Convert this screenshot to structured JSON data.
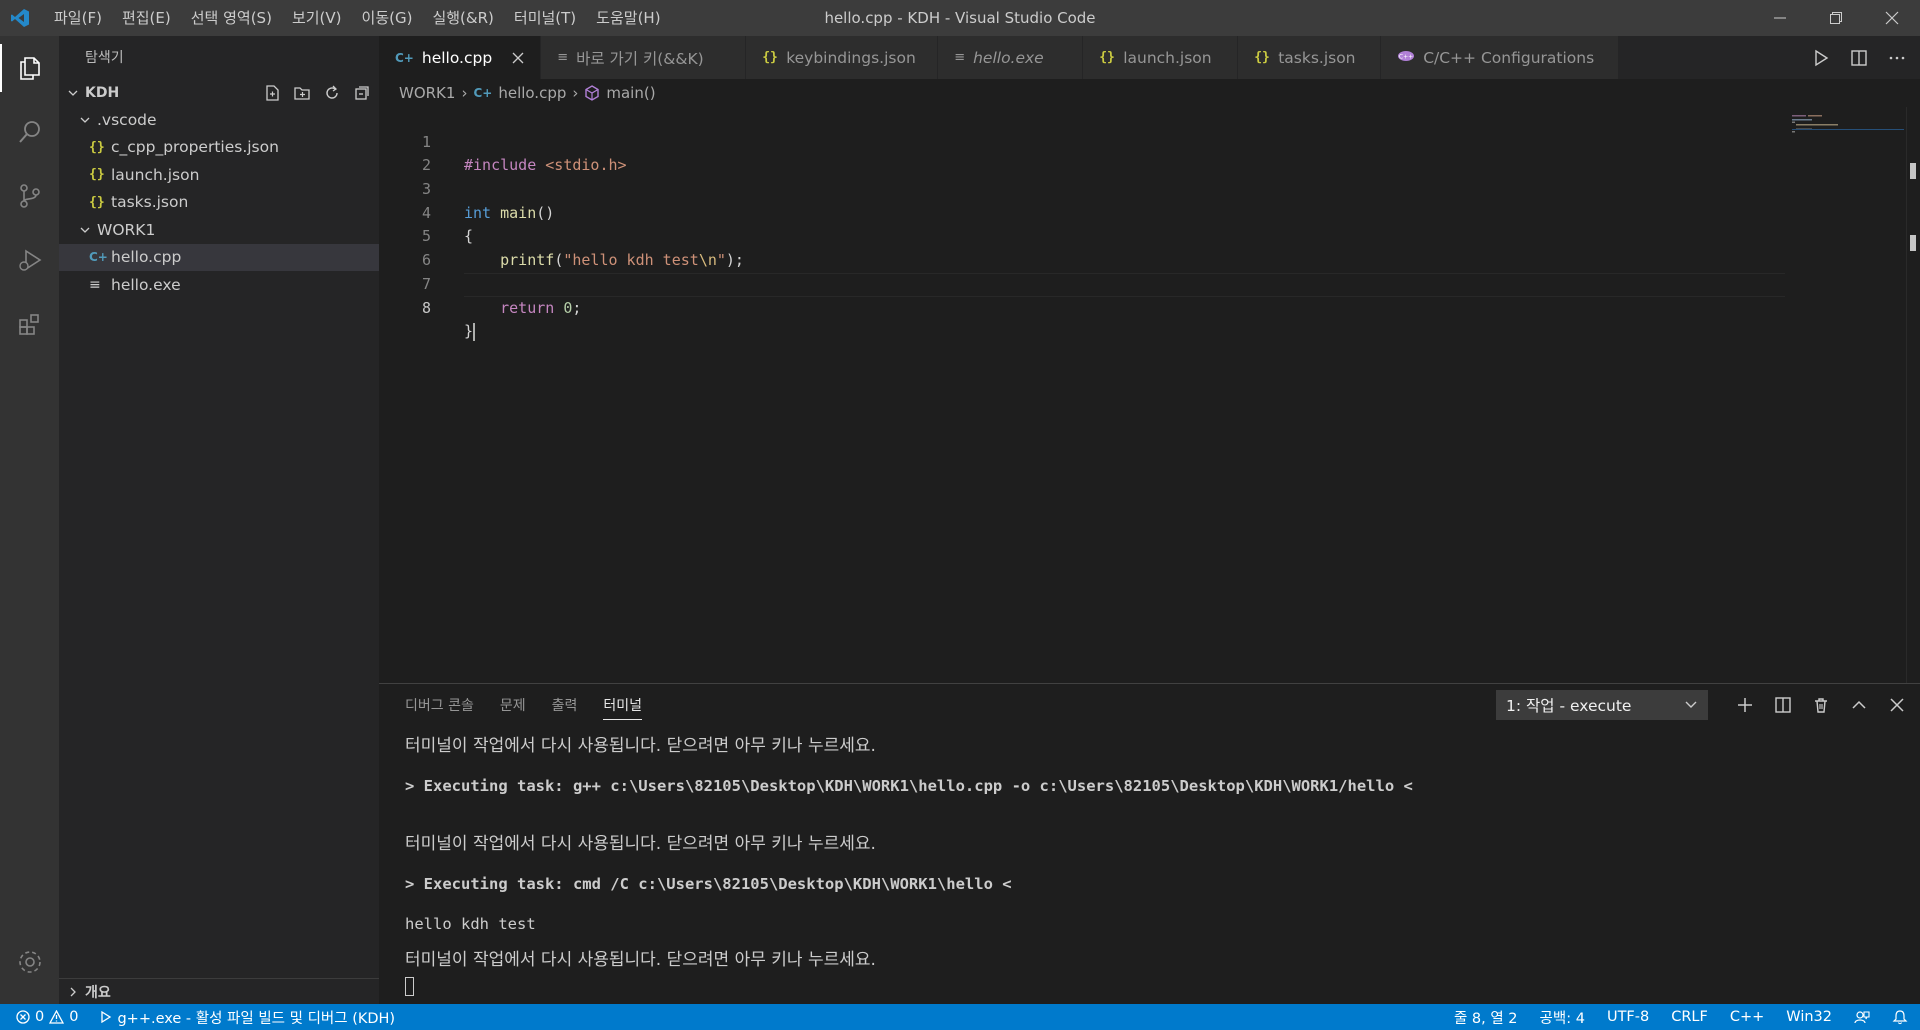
{
  "window": {
    "title": "hello.cpp - KDH - Visual Studio Code",
    "menu": [
      "파일(F)",
      "편집(E)",
      "선택 영역(S)",
      "보기(V)",
      "이동(G)",
      "실행(&R)",
      "터미널(T)",
      "도움말(H)"
    ]
  },
  "sidebar": {
    "title": "탐색기",
    "workspace": "KDH",
    "tree": {
      "vscode_folder": ".vscode",
      "vscode_files": [
        "c_cpp_properties.json",
        "launch.json",
        "tasks.json"
      ],
      "work_folder": "WORK1",
      "work_files": [
        "hello.cpp",
        "hello.exe"
      ]
    },
    "outline_label": "개요"
  },
  "tabs": [
    {
      "label": "hello.cpp",
      "icon": "cpp-icon"
    },
    {
      "label": "바로 가기 키(&&K)",
      "icon": "list-icon"
    },
    {
      "label": "keybindings.json",
      "icon": "json-icon"
    },
    {
      "label": "hello.exe",
      "icon": "list-icon"
    },
    {
      "label": "launch.json",
      "icon": "json-icon"
    },
    {
      "label": "tasks.json",
      "icon": "json-icon"
    },
    {
      "label": "C/C++ Configurations",
      "icon": "cpp-config-icon"
    }
  ],
  "breadcrumb": [
    "WORK1",
    "hello.cpp",
    "main()"
  ],
  "editor": {
    "line_numbers": [
      "1",
      "2",
      "3",
      "4",
      "5",
      "6",
      "7",
      "8"
    ],
    "lines": [
      {
        "pre": "#include",
        "inc": " <stdio.h>"
      },
      {},
      {
        "kw": "int",
        "fn": " main",
        "pl": "()"
      },
      {
        "pl": "{"
      },
      {
        "indent": "    ",
        "fn": "printf",
        "pl1": "(",
        "str": "\"hello kdh test",
        "esc": "\\n",
        "str2": "\"",
        "pl2": ");"
      },
      {},
      {
        "indent": "    ",
        "kw": "return",
        "num": " 0",
        "pl": ";"
      },
      {
        "pl": "}"
      }
    ]
  },
  "panel": {
    "tabs": [
      "디버그 콘솔",
      "문제",
      "출력",
      "터미널"
    ],
    "active_tab": "터미널",
    "terminal_select": "1: 작업 - execute",
    "terminal_lines": [
      "터미널이 작업에서 다시 사용됩니다. 닫으려면 아무 키나 누르세요.",
      "> Executing task: g++ c:\\Users\\82105\\Desktop\\KDH\\WORK1\\hello.cpp -o c:\\Users\\82105\\Desktop\\KDH\\WORK1/hello <",
      "",
      "터미널이 작업에서 다시 사용됩니다. 닫으려면 아무 키나 누르세요.",
      "> Executing task: cmd /C c:\\Users\\82105\\Desktop\\KDH\\WORK1\\hello <",
      "hello kdh test",
      "터미널이 작업에서 다시 사용됩니다. 닫으려면 아무 키나 누르세요."
    ]
  },
  "statusbar": {
    "errors": "0",
    "warnings": "0",
    "task": "g++.exe - 활성 파일 빌드 및 디버그 (KDH)",
    "position": "줄 8, 열 2",
    "spaces": "공백: 4",
    "encoding": "UTF-8",
    "eol": "CRLF",
    "language": "C++",
    "platform": "Win32"
  },
  "colors": {
    "accent": "#007acc",
    "editor_bg": "#1e1e1e",
    "sidebar_bg": "#252526"
  }
}
